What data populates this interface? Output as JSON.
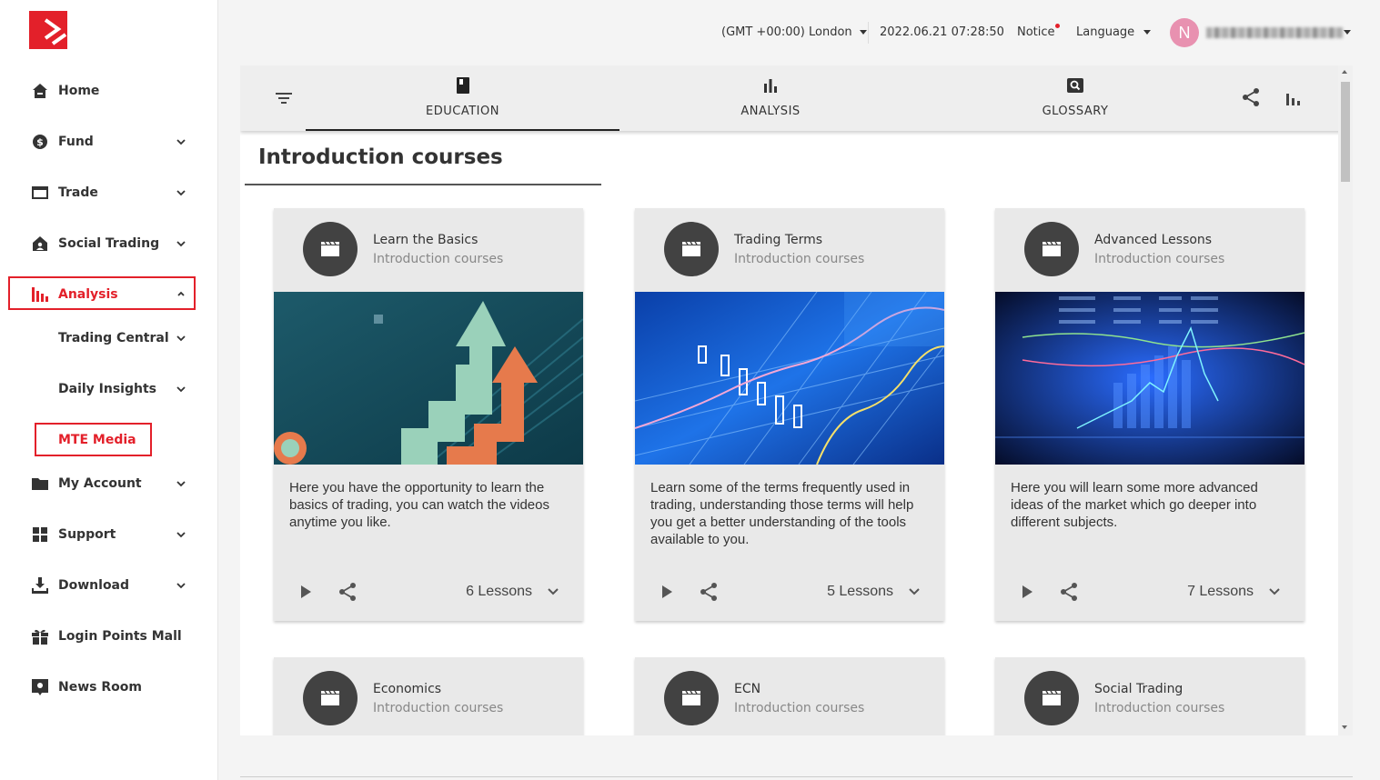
{
  "sidebar": {
    "items": [
      {
        "label": "Home",
        "icon": "home-icon"
      },
      {
        "label": "Fund",
        "icon": "dollar-circle-icon"
      },
      {
        "label": "Trade",
        "icon": "card-icon"
      },
      {
        "label": "Social Trading",
        "icon": "house-user-icon"
      },
      {
        "label": "Analysis",
        "icon": "bar-chart-icon"
      },
      {
        "label": "My Account",
        "icon": "folder-icon"
      },
      {
        "label": "Support",
        "icon": "grid-icon"
      },
      {
        "label": "Download",
        "icon": "download-icon"
      },
      {
        "label": "Login Points Mall",
        "icon": "gift-icon"
      },
      {
        "label": "News Room",
        "icon": "news-icon"
      }
    ],
    "sub_items": [
      {
        "label": "Trading Central"
      },
      {
        "label": "Daily Insights"
      },
      {
        "label": "MTE Media"
      }
    ],
    "accent": "#e3202a"
  },
  "topbar": {
    "timezone": "(GMT +00:00) London",
    "datetime": "2022.06.21 07:28:50",
    "notice": "Notice",
    "language": "Language",
    "avatar_initial": "N",
    "avatar_color": "#e891b0"
  },
  "tabs": [
    {
      "label": "EDUCATION",
      "icon": "book-icon"
    },
    {
      "label": "ANALYSIS",
      "icon": "bar-chart-icon"
    },
    {
      "label": "GLOSSARY",
      "icon": "search-box-icon"
    }
  ],
  "section": {
    "title": "Introduction courses"
  },
  "cards": [
    {
      "title": "Learn the Basics",
      "subtitle": "Introduction courses",
      "description": "Here you have the opportunity to learn the basics of trading, you can watch the videos anytime you like.",
      "lessons": "6 Lessons"
    },
    {
      "title": "Trading Terms",
      "subtitle": "Introduction courses",
      "description": "Learn some of the terms frequently used in trading, understanding those terms will help you get a better understanding of the tools available to you.",
      "lessons": "5 Lessons"
    },
    {
      "title": "Advanced Lessons",
      "subtitle": "Introduction courses",
      "description": "Here you will learn some more advanced ideas of the market which go deeper into different subjects.",
      "lessons": "7 Lessons"
    },
    {
      "title": "Economics",
      "subtitle": "Introduction courses"
    },
    {
      "title": "ECN",
      "subtitle": "Introduction courses"
    },
    {
      "title": "Social Trading",
      "subtitle": "Introduction courses"
    }
  ]
}
